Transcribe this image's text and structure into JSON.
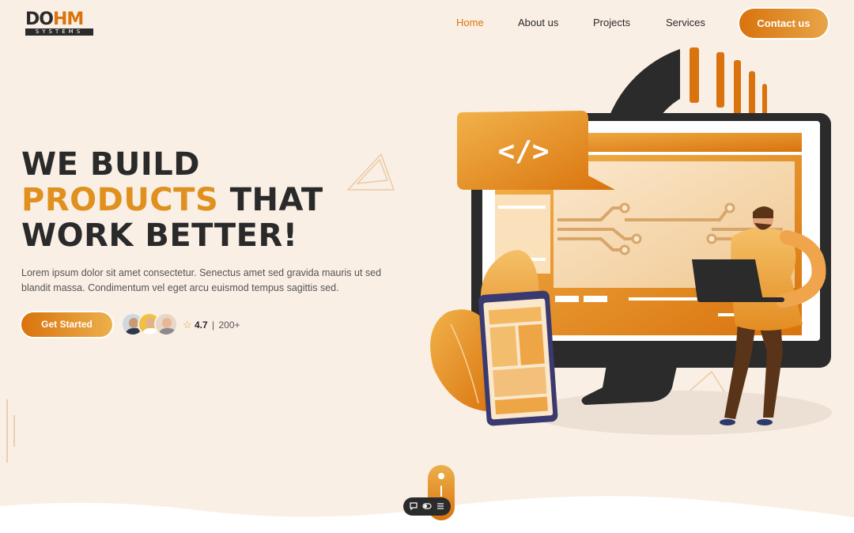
{
  "brand": {
    "mark_dark": "DO",
    "mark_accent": "HM",
    "sub": "SYSTEMS"
  },
  "nav": {
    "items": [
      {
        "label": "Home",
        "active": true
      },
      {
        "label": "About us",
        "active": false
      },
      {
        "label": "Projects",
        "active": false
      },
      {
        "label": "Services",
        "active": false
      }
    ],
    "contact_label": "Contact us"
  },
  "hero": {
    "line1": "WE BUILD",
    "line2_accent": "PRODUCTS",
    "line2_rest": "THAT",
    "line3": "WORK BETTER!",
    "lead": "Lorem ipsum dolor sit amet consectetur. Senectus amet sed gravida mauris ut sed blandit massa. Condimentum vel eget arcu euismod tempus sagittis sed.",
    "cta_label": "Get Started",
    "rating": "4.7",
    "rating_sep": "|",
    "review_count": "200+",
    "code_tag": "</>"
  },
  "icons": {
    "star": "star-icon",
    "chat": "chat-icon",
    "toggle": "toggle-icon",
    "settings": "sliders-icon"
  },
  "colors": {
    "background": "#faefe5",
    "accent": "#d9730d",
    "accent_light": "#ecb04c",
    "dark": "#2b2b2b"
  }
}
